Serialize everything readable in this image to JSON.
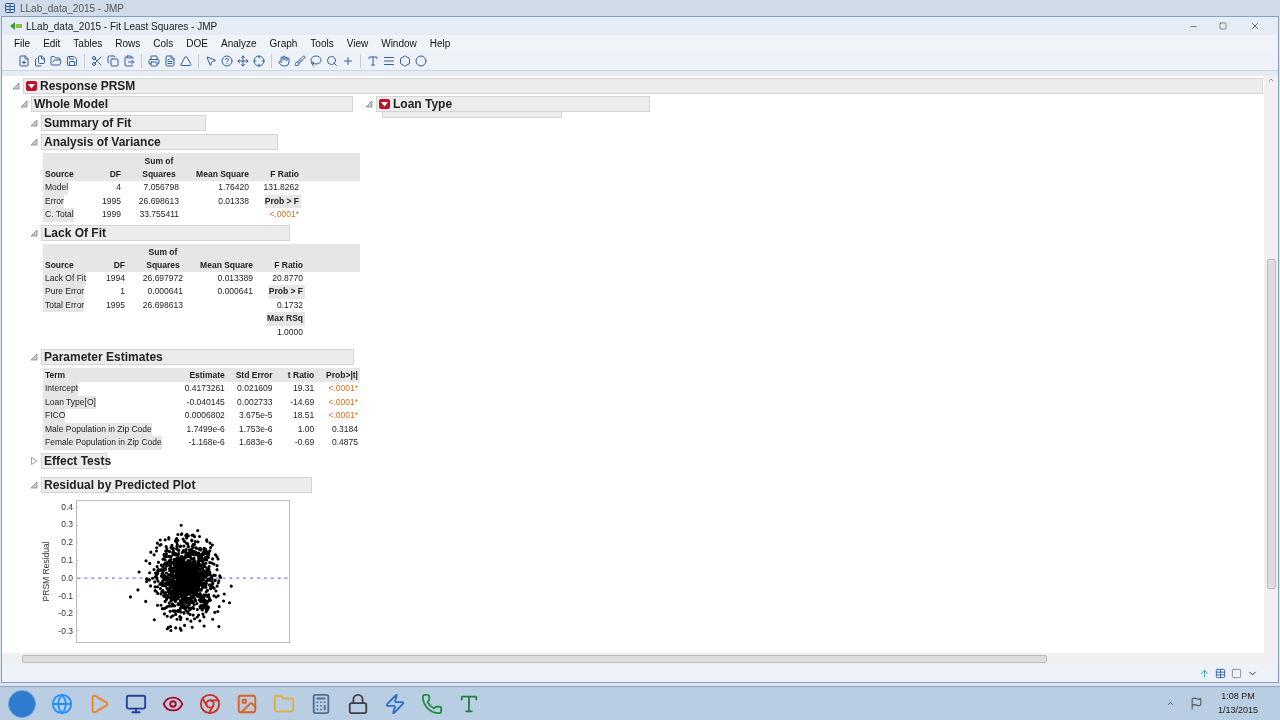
{
  "outer_window": {
    "title": "LLab_data_2015 - JMP"
  },
  "window": {
    "title": "LLab_data_2015 - Fit Least Squares - JMP"
  },
  "menu": [
    "File",
    "Edit",
    "Tables",
    "Rows",
    "Cols",
    "DOE",
    "Analyze",
    "Graph",
    "Tools",
    "View",
    "Window",
    "Help"
  ],
  "report": {
    "title": "Response PRSM",
    "expanded": true,
    "whole_model": {
      "title": "Whole Model",
      "expanded": true,
      "summary_of_fit": {
        "title": "Summary of Fit",
        "expanded": true
      },
      "analysis_of_variance": {
        "title": "Analysis of Variance",
        "expanded": true,
        "columns": [
          "Source",
          "DF",
          "Sum of Squares",
          "Mean Square",
          "F Ratio"
        ],
        "rows": [
          [
            {
              "text": "Model",
              "kind": "term"
            },
            {
              "text": "4",
              "kind": "value"
            },
            {
              "text": "7.056798",
              "kind": "value"
            },
            {
              "text": "1.76420",
              "kind": "value"
            },
            {
              "text": "131.8262",
              "kind": "value"
            }
          ],
          [
            {
              "text": "Error",
              "kind": "term"
            },
            {
              "text": "1995",
              "kind": "value"
            },
            {
              "text": "26.698613",
              "kind": "value"
            },
            {
              "text": "0.01338",
              "kind": "value"
            },
            {
              "text": "Prob > F",
              "kind": "label"
            }
          ],
          [
            {
              "text": "C. Total",
              "kind": "term"
            },
            {
              "text": "1999",
              "kind": "value"
            },
            {
              "text": "33.755411",
              "kind": "value"
            },
            null,
            {
              "text": "<.0001*",
              "kind": "significant"
            }
          ]
        ]
      },
      "lack_of_fit": {
        "title": "Lack Of Fit",
        "expanded": true,
        "columns": [
          "Source",
          "DF",
          "Sum of Squares",
          "Mean Square",
          "F Ratio"
        ],
        "rows": [
          [
            {
              "text": "Lack Of Fit",
              "kind": "term"
            },
            {
              "text": "1994",
              "kind": "value"
            },
            {
              "text": "26.697972",
              "kind": "value"
            },
            {
              "text": "0.013389",
              "kind": "value"
            },
            {
              "text": "20.8770",
              "kind": "value"
            }
          ],
          [
            {
              "text": "Pure Error",
              "kind": "term"
            },
            {
              "text": "1",
              "kind": "value"
            },
            {
              "text": "0.000641",
              "kind": "value"
            },
            {
              "text": "0.000641",
              "kind": "value"
            },
            {
              "text": "Prob > F",
              "kind": "label"
            }
          ],
          [
            {
              "text": "Total Error",
              "kind": "term"
            },
            {
              "text": "1995",
              "kind": "value"
            },
            {
              "text": "26.698613",
              "kind": "value"
            },
            null,
            {
              "text": "0.1732",
              "kind": "value"
            }
          ],
          [
            null,
            null,
            null,
            null,
            {
              "text": "Max RSq",
              "kind": "label"
            }
          ],
          [
            null,
            null,
            null,
            null,
            {
              "text": "1.0000",
              "kind": "value"
            }
          ]
        ]
      },
      "parameter_estimates": {
        "title": "Parameter Estimates",
        "expanded": true,
        "columns": [
          "Term",
          "Estimate",
          "Std Error",
          "t Ratio",
          "Prob>|t|"
        ],
        "rows": [
          [
            {
              "text": "Intercept",
              "kind": "term"
            },
            {
              "text": "0.4173261",
              "kind": "value"
            },
            {
              "text": "0.021609",
              "kind": "value"
            },
            {
              "text": "19.31",
              "kind": "value"
            },
            {
              "text": "<.0001*",
              "kind": "significant"
            }
          ],
          [
            {
              "text": "Loan Type[O]",
              "kind": "term"
            },
            {
              "text": "-0.040145",
              "kind": "value"
            },
            {
              "text": "0.002733",
              "kind": "value"
            },
            {
              "text": "-14.69",
              "kind": "value"
            },
            {
              "text": "<.0001*",
              "kind": "significant"
            }
          ],
          [
            {
              "text": "FICO",
              "kind": "term"
            },
            {
              "text": "0.0006802",
              "kind": "value"
            },
            {
              "text": "3.675e-5",
              "kind": "value"
            },
            {
              "text": "18.51",
              "kind": "value"
            },
            {
              "text": "<.0001*",
              "kind": "significant"
            }
          ],
          [
            {
              "text": "Male Population in Zip Code",
              "kind": "term"
            },
            {
              "text": "1.7499e-6",
              "kind": "value"
            },
            {
              "text": "1.753e-6",
              "kind": "value"
            },
            {
              "text": "1.00",
              "kind": "value"
            },
            {
              "text": "0.3184",
              "kind": "value"
            }
          ],
          [
            {
              "text": "Female Population in Zip Code",
              "kind": "term"
            },
            {
              "text": "-1.168e-6",
              "kind": "value"
            },
            {
              "text": "1.683e-6",
              "kind": "value"
            },
            {
              "text": "-0.69",
              "kind": "value"
            },
            {
              "text": "0.4875",
              "kind": "value"
            }
          ]
        ]
      },
      "effect_tests": {
        "title": "Effect Tests",
        "expanded": false
      },
      "residual_plot": {
        "title": "Residual by Predicted Plot",
        "expanded": true,
        "ylabel": "PRSM Residual",
        "y_tick_labels": [
          "0.4",
          "0.3",
          "0.2",
          "0.1",
          "0.0",
          "-0.1",
          "-0.2",
          "-0.3"
        ]
      }
    },
    "loan_type": {
      "title": "Loan Type",
      "expanded": true
    }
  },
  "clock": {
    "time": "1:08 PM",
    "date": "1/13/2015"
  }
}
